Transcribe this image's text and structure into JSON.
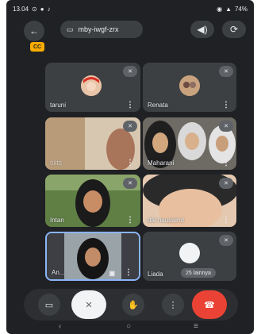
{
  "status": {
    "time": "13.04",
    "battery": "74%"
  },
  "header": {
    "meeting_code": "mby-iwgf-zrx"
  },
  "badge": {
    "label": "㏄"
  },
  "participants": [
    {
      "name": "taruni"
    },
    {
      "name": "Renata"
    },
    {
      "name": "ttitttt"
    },
    {
      "name": "Maharani"
    },
    {
      "name": "Intan"
    },
    {
      "name": "dai naudaind"
    },
    {
      "name": "An..."
    },
    {
      "name": "Liada"
    }
  ],
  "others_chip": {
    "label": "25 lainnya"
  },
  "colors": {
    "end_call": "#ea4335",
    "active_border": "#8ab4f8",
    "cc_badge": "#f9ab00"
  }
}
